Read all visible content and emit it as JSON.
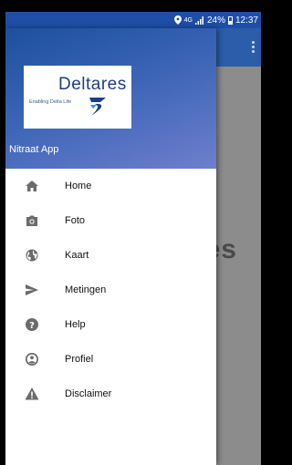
{
  "status_bar": {
    "network": "4G",
    "battery": "24%",
    "time": "12:37"
  },
  "background": {
    "partial_text": "es"
  },
  "drawer": {
    "logo": {
      "title": "Deltares",
      "tagline": "Enabling Delta Life"
    },
    "app_name": "Nitraat App",
    "items": [
      {
        "label": "Home",
        "icon": "home-icon"
      },
      {
        "label": "Foto",
        "icon": "camera-icon"
      },
      {
        "label": "Kaart",
        "icon": "globe-icon"
      },
      {
        "label": "Metingen",
        "icon": "send-icon"
      },
      {
        "label": "Help",
        "icon": "help-icon"
      },
      {
        "label": "Profiel",
        "icon": "account-icon"
      },
      {
        "label": "Disclaimer",
        "icon": "warning-icon"
      }
    ]
  },
  "colors": {
    "status_bar": "#1e4fa8",
    "toolbar": "#2b5dab",
    "icon_gray": "#6b6b6b"
  }
}
